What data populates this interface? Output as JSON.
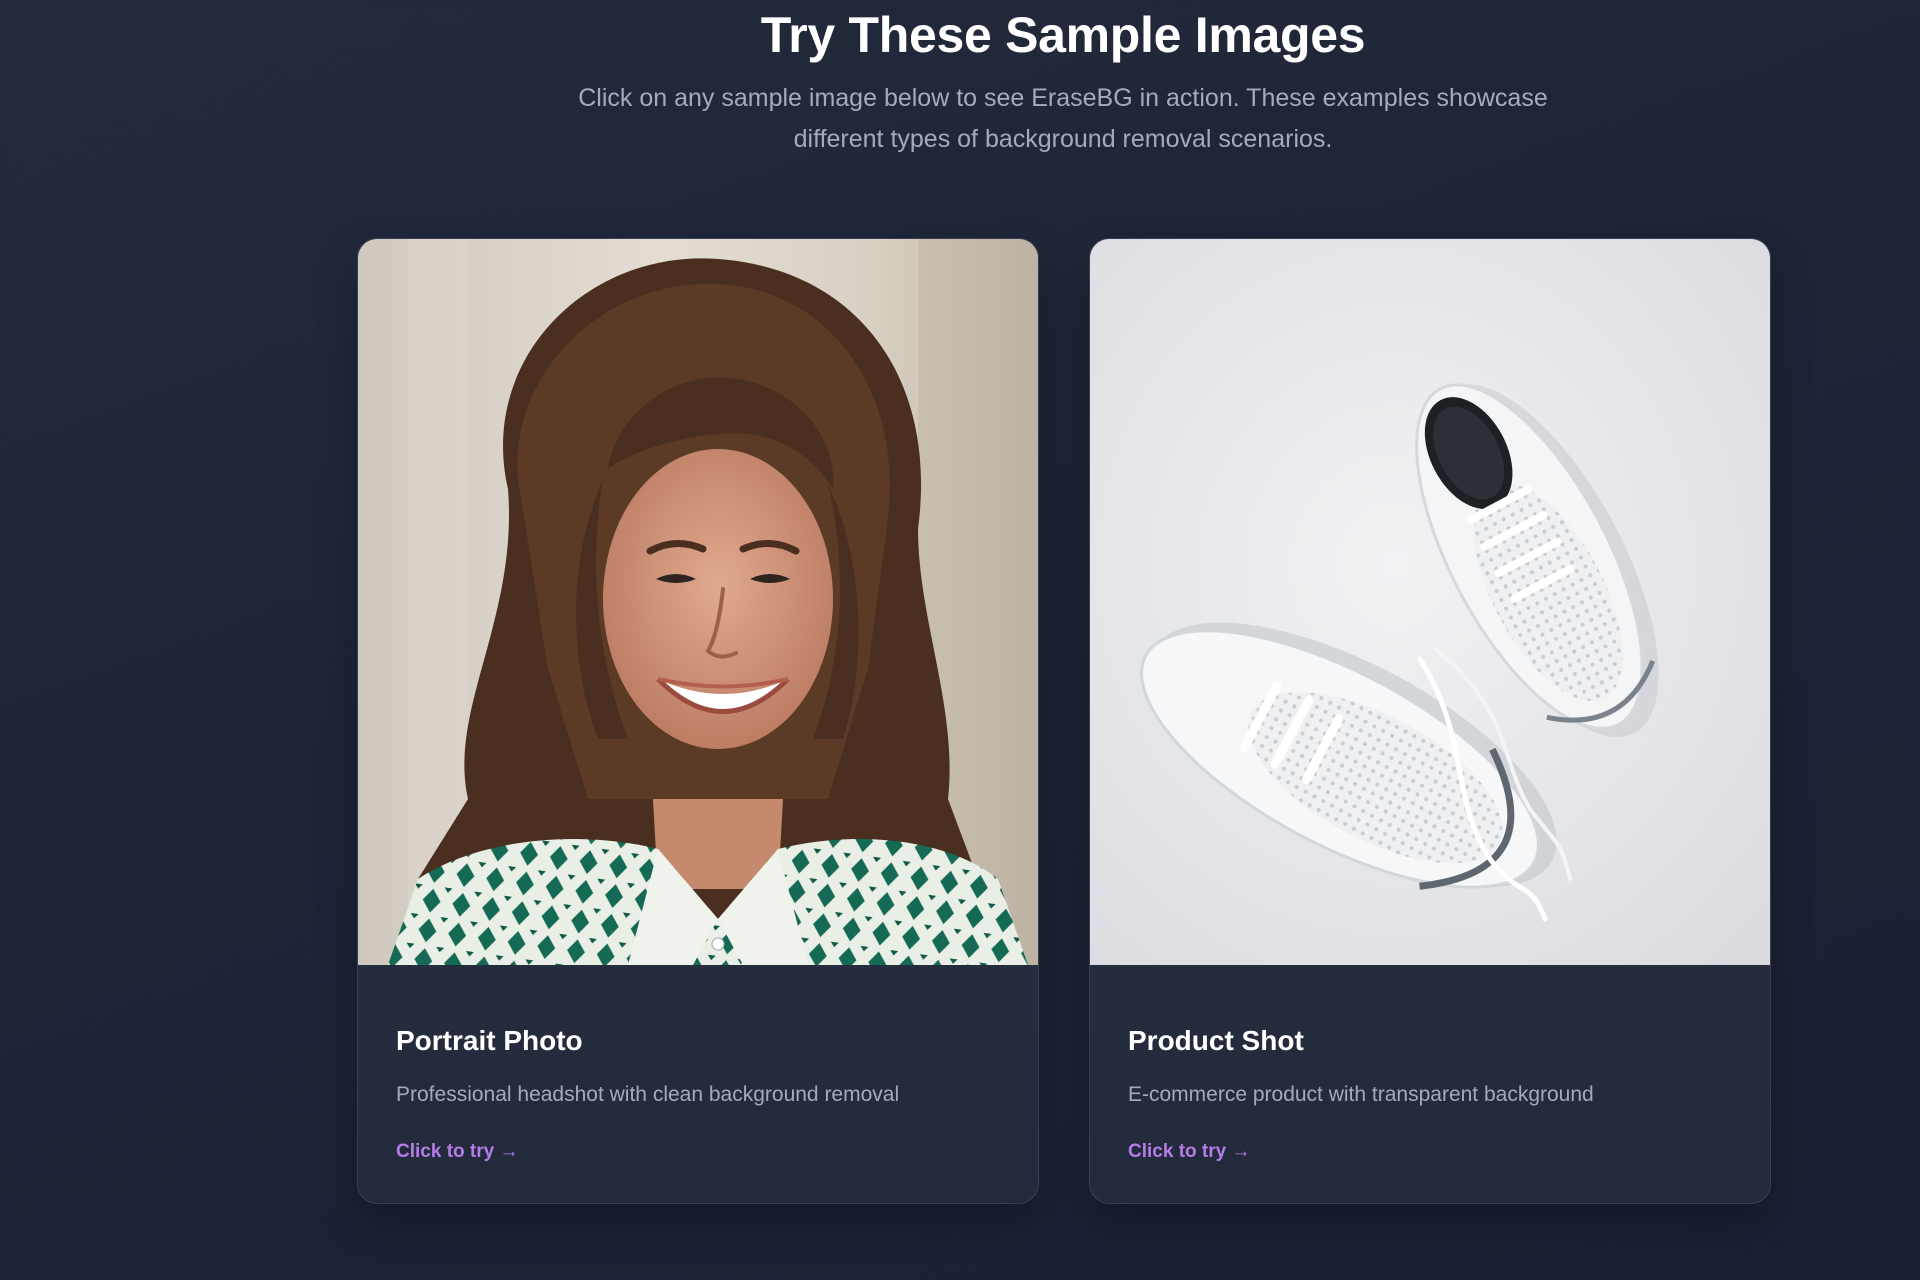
{
  "header": {
    "title": "Try These Sample Images",
    "subtitle": "Click on any sample image below to see EraseBG in action. These examples showcase different types of background removal scenarios."
  },
  "samples": [
    {
      "title": "Portrait Photo",
      "description": "Professional headshot with clean background removal",
      "cta": "Click to try →",
      "image_alt": "smiling woman with curly brown hair wearing a green and white patterned shirt"
    },
    {
      "title": "Product Shot",
      "description": "E-commerce product with transparent background",
      "cta": "Click to try →",
      "image_alt": "pair of white running sneakers on a light grey surface"
    }
  ],
  "colors": {
    "background": "#1d2436",
    "card": "#262e40",
    "accent": "#b57ce8",
    "muted_text": "#a3acbd"
  }
}
